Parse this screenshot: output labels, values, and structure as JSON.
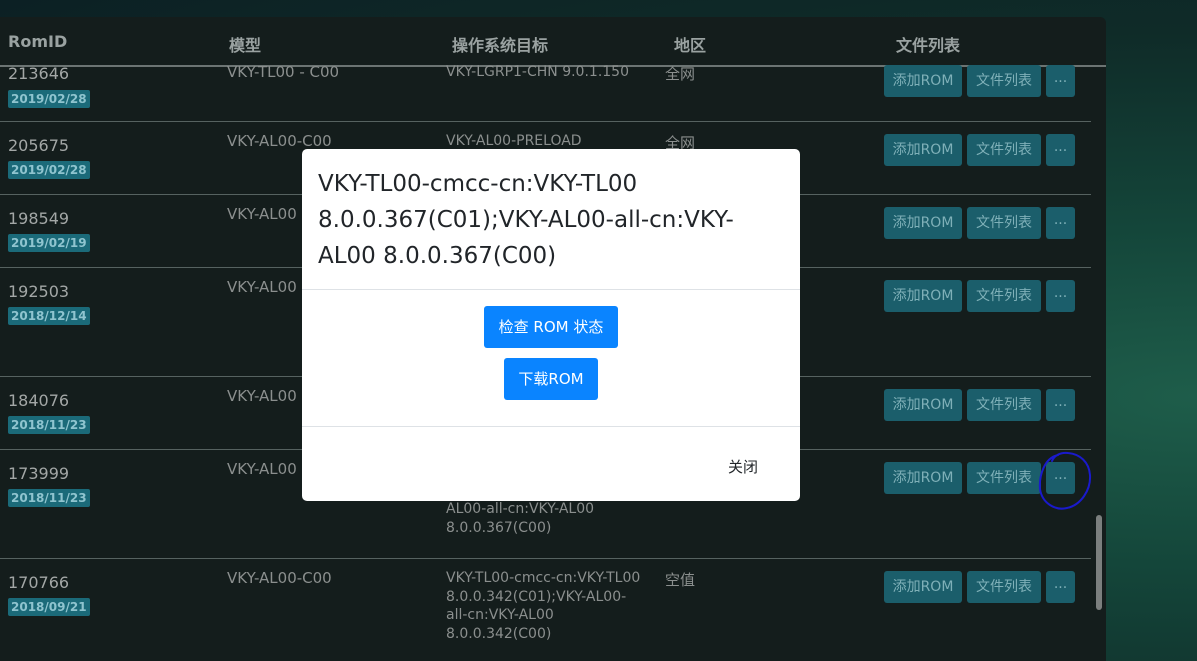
{
  "table": {
    "headers": {
      "romid": "RomID",
      "model": "模型",
      "os_target": "操作系统目标",
      "region": "地区",
      "file_list": "文件列表"
    },
    "button_labels": {
      "add_rom": "添加ROM",
      "file_list": "文件列表",
      "more": "..."
    },
    "rows": [
      {
        "id": "213646",
        "date": "2019/02/28",
        "model": "VKY-TL00 - C00",
        "os": "VKY-LGRP1-CHN 9.0.1.150",
        "region": "全网"
      },
      {
        "id": "205675",
        "date": "2019/02/28",
        "model": "VKY-AL00-C00",
        "os": "VKY-AL00-PRELOAD",
        "region": "全网"
      },
      {
        "id": "198549",
        "date": "2019/02/19",
        "model": "VKY-AL00",
        "os": "",
        "region": ""
      },
      {
        "id": "192503",
        "date": "2018/12/14",
        "model": "VKY-AL00",
        "os": "",
        "region": ""
      },
      {
        "id": "184076",
        "date": "2018/11/23",
        "model": "VKY-AL00",
        "os": "",
        "region": ""
      },
      {
        "id": "173999",
        "date": "2018/11/23",
        "model": "VKY-AL00",
        "os": "AL00-all-cn:VKY-AL00 8.0.0.367(C00)",
        "region": ""
      },
      {
        "id": "170766",
        "date": "2018/09/21",
        "model": "VKY-AL00-C00",
        "os": "VKY-TL00-cmcc-cn:VKY-TL00 8.0.0.342(C01);VKY-AL00-all-cn:VKY-AL00 8.0.0.342(C00)",
        "region": "空值"
      }
    ]
  },
  "modal": {
    "title": "VKY-TL00-cmcc-cn:VKY-TL00 8.0.0.367(C01);VKY-AL00-all-cn:VKY-AL00 8.0.0.367(C00)",
    "check_label": "检查 ROM 状态",
    "download_label": "下载ROM",
    "close_label": "关闭"
  },
  "colors": {
    "primary": "#0a84ff",
    "badge": "#1b6a79",
    "row_button": "#1b5e6b",
    "annotation": "#1a1acc"
  }
}
